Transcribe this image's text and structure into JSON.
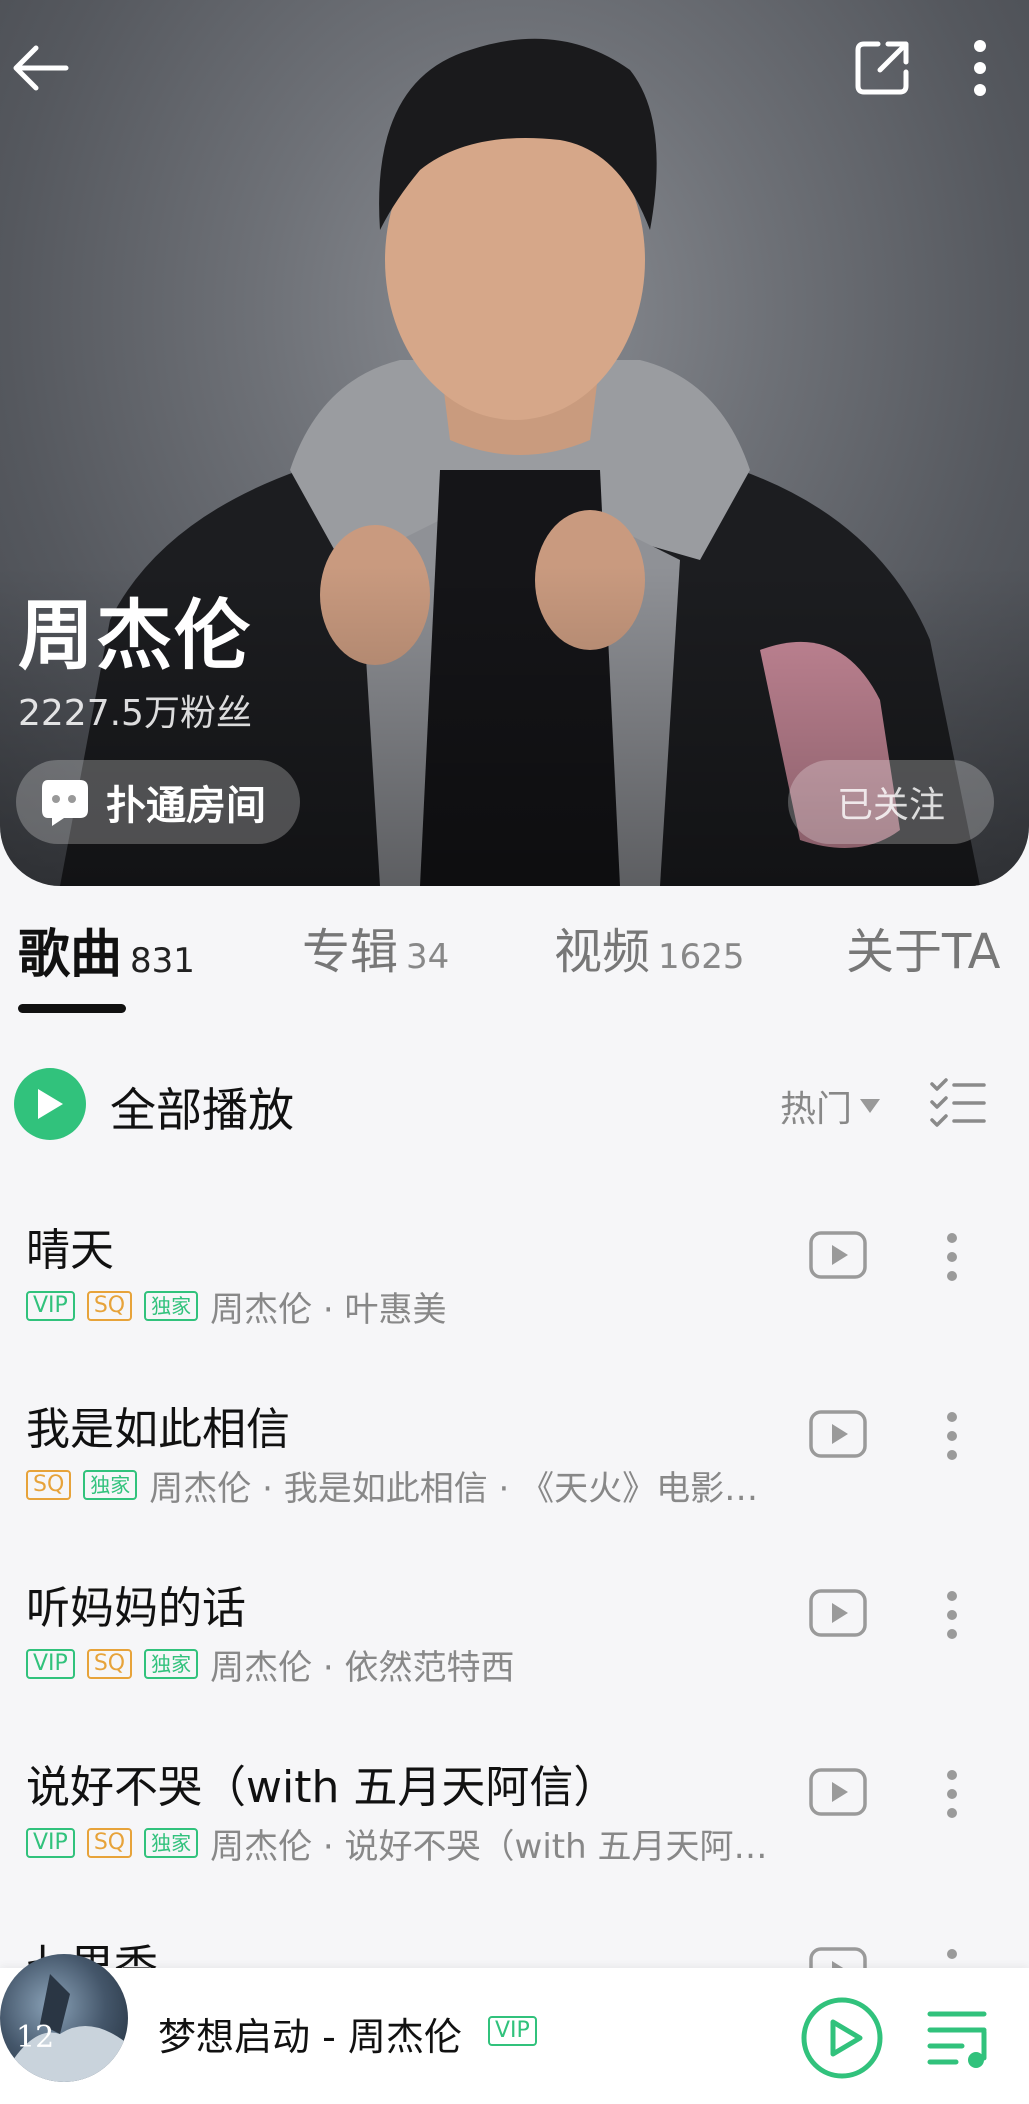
{
  "artist": {
    "name": "周杰伦",
    "fans": "2227.5万粉丝",
    "room_label": "扑通房间",
    "follow_label": "已关注"
  },
  "tabs": [
    {
      "label": "歌曲",
      "count": "831"
    },
    {
      "label": "专辑",
      "count": "34"
    },
    {
      "label": "视频",
      "count": "1625"
    },
    {
      "label": "关于TA",
      "count": ""
    }
  ],
  "playall": {
    "label": "全部播放",
    "sort_label": "热门"
  },
  "songs": [
    {
      "title": "晴天",
      "badges": [
        "VIP",
        "SQ",
        "独家"
      ],
      "artist": "周杰伦 · 叶惠美"
    },
    {
      "title": "我是如此相信",
      "badges": [
        "SQ",
        "独家"
      ],
      "artist": "周杰伦 · 我是如此相信 · 《天火》电影…"
    },
    {
      "title": "听妈妈的话",
      "badges": [
        "VIP",
        "SQ",
        "独家"
      ],
      "artist": "周杰伦 · 依然范特西"
    },
    {
      "title": "说好不哭（with 五月天阿信）",
      "badges": [
        "VIP",
        "SQ",
        "独家"
      ],
      "artist": "周杰伦 · 说好不哭（with 五月天阿…"
    },
    {
      "title": "七里香",
      "badges": [],
      "artist": ""
    }
  ],
  "now_playing": {
    "title": "梦想启动 - 周杰伦",
    "badge": "VIP",
    "cover_text": "12"
  },
  "colors": {
    "accent": "#31c27c",
    "sq": "#e7a33a",
    "background": "#f6f6f8"
  },
  "icons": [
    "back-arrow-icon",
    "share-icon",
    "more-vertical-icon",
    "play-icon",
    "multi-select-list-icon",
    "mv-play-icon",
    "playlist-queue-icon"
  ]
}
